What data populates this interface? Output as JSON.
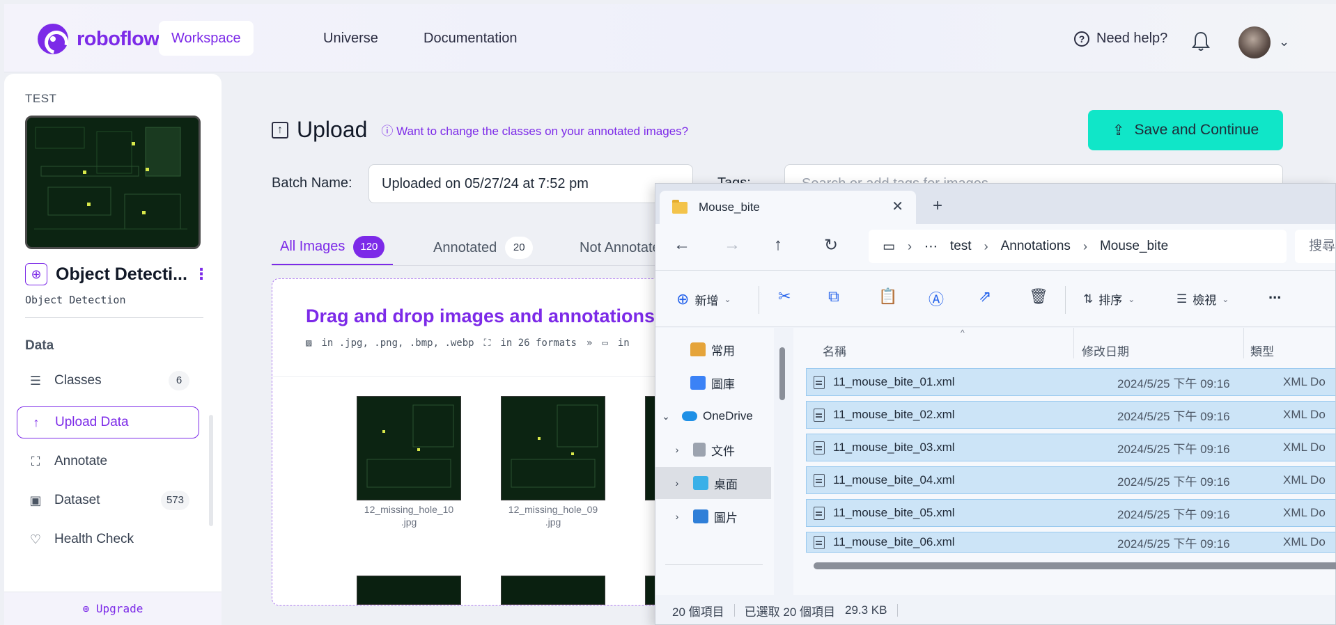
{
  "brand": {
    "name": "roboflow",
    "accent": "#7c2ae8",
    "cta": "#10e6c8"
  },
  "topnav": {
    "tabs": [
      {
        "label": "Workspace",
        "active": true
      },
      {
        "label": "Universe",
        "active": false
      },
      {
        "label": "Documentation",
        "active": false
      }
    ],
    "help": "Need help?",
    "icons": [
      "help-icon",
      "bell-icon",
      "avatar",
      "chevron-down-icon"
    ]
  },
  "sidebar": {
    "group": "TEST",
    "project_name": "Object Detecti...",
    "project_type": "Object Detection",
    "section": "Data",
    "items": [
      {
        "label": "Classes",
        "icon": "list-icon",
        "count": "6"
      },
      {
        "label": "Upload Data",
        "icon": "arrow-up-icon",
        "active": true
      },
      {
        "label": "Annotate",
        "icon": "annotate-icon"
      },
      {
        "label": "Dataset",
        "icon": "images-icon",
        "count": "573"
      },
      {
        "label": "Health Check",
        "icon": "heartbeat-icon"
      }
    ],
    "upgrade": "Upgrade"
  },
  "main": {
    "title": "Upload",
    "classes_link": "Want to change the classes on your annotated images?",
    "save_button": "Save and Continue",
    "batch_label": "Batch Name:",
    "batch_value": "Uploaded on 05/27/24 at 7:52 pm",
    "tags_label": "Tags:",
    "tags_placeholder": "Search or add tags for images...",
    "tabs": [
      {
        "label": "All Images",
        "count": "120",
        "active": true
      },
      {
        "label": "Annotated",
        "count": "20"
      },
      {
        "label": "Not Annotated"
      }
    ],
    "dropzone": {
      "title": "Drag and drop images and annotations",
      "formats": [
        "in .jpg, .png, .bmp, .webp",
        "in 26 formats",
        "in"
      ]
    },
    "thumbnails": [
      {
        "caption_1": "12_missing_hole_10",
        "caption_2": ".jpg"
      },
      {
        "caption_1": "12_missing_hole_09",
        "caption_2": ".jpg"
      }
    ]
  },
  "explorer": {
    "tab_title": "Mouse_bite",
    "path": [
      "test",
      "Annotations",
      "Mouse_bite"
    ],
    "search_placeholder": "搜尋",
    "toolbar": {
      "new": "新增",
      "sort": "排序",
      "view": "檢視",
      "more": "..."
    },
    "nav": [
      {
        "label": "常用",
        "icon": "home-icon"
      },
      {
        "label": "圖庫",
        "icon": "gallery-icon"
      },
      {
        "label": "OneDrive",
        "icon": "cloud-icon",
        "expanded": true
      },
      {
        "label": "文件",
        "icon": "document-icon"
      },
      {
        "label": "桌面",
        "icon": "desktop-icon",
        "selected": true
      },
      {
        "label": "圖片",
        "icon": "pictures-icon"
      }
    ],
    "columns": [
      "名稱",
      "修改日期",
      "類型"
    ],
    "files": [
      {
        "name": "11_mouse_bite_01.xml",
        "date": "2024/5/25 下午 09:16",
        "type": "XML Do"
      },
      {
        "name": "11_mouse_bite_02.xml",
        "date": "2024/5/25 下午 09:16",
        "type": "XML Do"
      },
      {
        "name": "11_mouse_bite_03.xml",
        "date": "2024/5/25 下午 09:16",
        "type": "XML Do"
      },
      {
        "name": "11_mouse_bite_04.xml",
        "date": "2024/5/25 下午 09:16",
        "type": "XML Do"
      },
      {
        "name": "11_mouse_bite_05.xml",
        "date": "2024/5/25 下午 09:16",
        "type": "XML Do"
      },
      {
        "name": "11_mouse_bite_06.xml",
        "date": "2024/5/25 下午 09:16",
        "type": "XML Do"
      }
    ],
    "status": {
      "count": "20 個項目",
      "selected": "已選取 20 個項目",
      "size": "29.3 KB"
    }
  }
}
